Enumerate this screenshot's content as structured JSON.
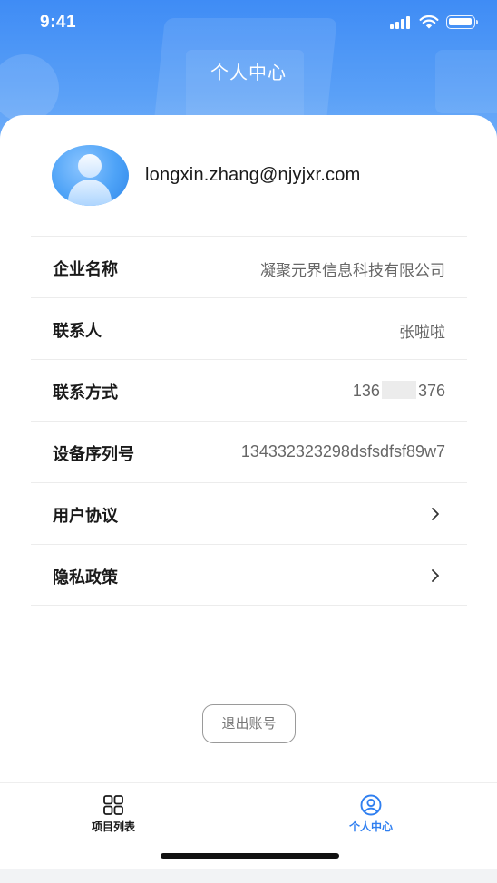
{
  "status_bar": {
    "time": "9:41"
  },
  "header": {
    "title": "个人中心"
  },
  "profile": {
    "email": "longxin.zhang@njyjxr.com"
  },
  "info_rows": [
    {
      "label": "企业名称",
      "value": "凝聚元界信息科技有限公司"
    },
    {
      "label": "联系人",
      "value": "张啦啦"
    },
    {
      "label": "联系方式",
      "value_prefix": "136",
      "value_suffix": "376"
    },
    {
      "label": "设备序列号",
      "value": "134332323298dsfsdfsf89w7"
    }
  ],
  "link_rows": [
    {
      "label": "用户协议",
      "icon": "chevron-right-icon"
    },
    {
      "label": "隐私政策",
      "icon": "chevron-right-icon"
    }
  ],
  "logout": {
    "label": "退出账号"
  },
  "tabbar": {
    "tabs": [
      {
        "label": "项目列表",
        "icon": "grid-icon",
        "active": false
      },
      {
        "label": "个人中心",
        "icon": "user-circle-icon",
        "active": true
      }
    ]
  },
  "colors": {
    "accent": "#2f7ff0",
    "header_gradient_top": "#3f8cf5",
    "inactive_tab": "#1a1a1a"
  }
}
